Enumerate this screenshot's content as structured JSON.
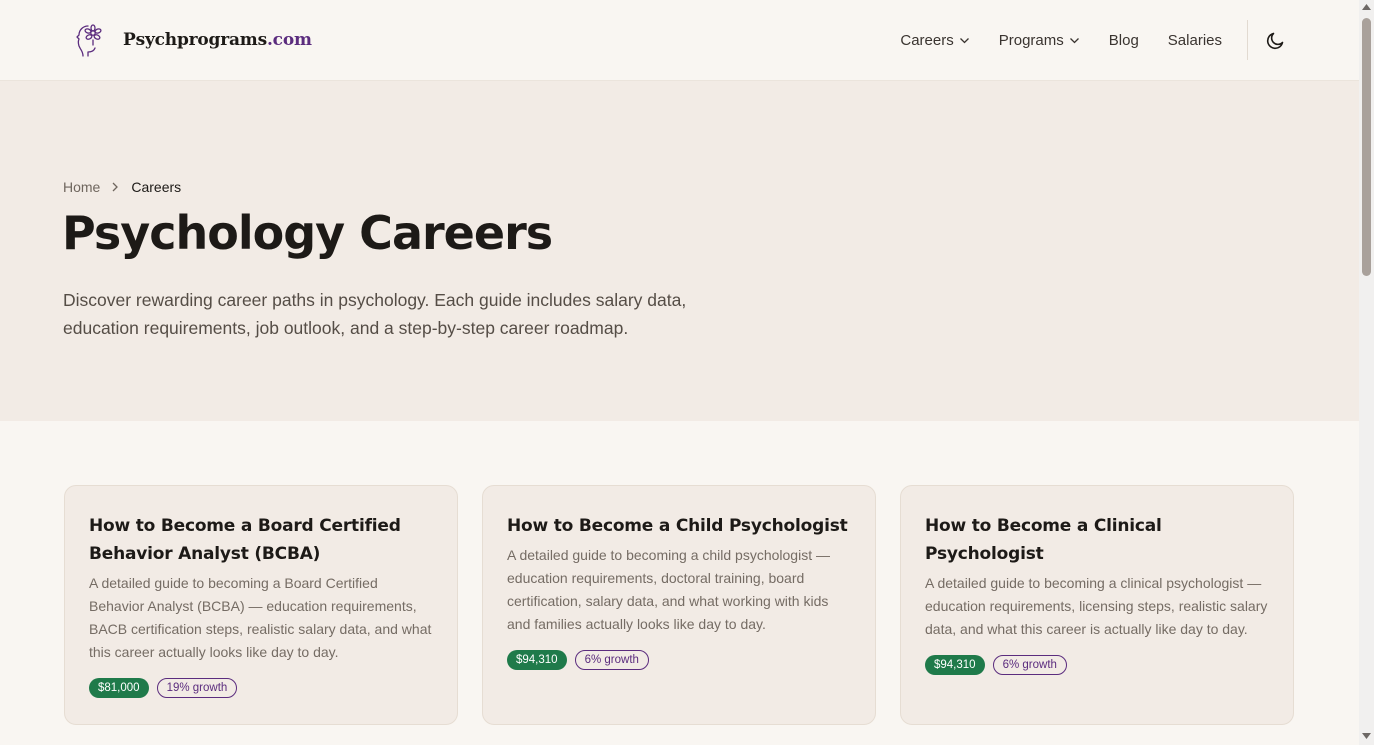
{
  "header": {
    "logo_name": "Psychprograms",
    "logo_tld": ".com",
    "nav": [
      {
        "label": "Careers",
        "has_dropdown": true
      },
      {
        "label": "Programs",
        "has_dropdown": true
      },
      {
        "label": "Blog",
        "has_dropdown": false
      },
      {
        "label": "Salaries",
        "has_dropdown": false
      }
    ],
    "theme_icon": "moon-icon"
  },
  "breadcrumb": {
    "home": "Home",
    "current": "Careers"
  },
  "hero": {
    "title": "Psychology Careers",
    "description": "Discover rewarding career paths in psychology. Each guide includes salary data, education requirements, job outlook, and a step-by-step career roadmap."
  },
  "cards": [
    {
      "title": "How to Become a Board Certified Behavior Analyst (BCBA)",
      "description": "A detailed guide to becoming a Board Certified Behavior Analyst (BCBA) — education requirements, BACB certification steps, realistic salary data, and what this career actually looks like day to day.",
      "salary": "$81,000",
      "growth": "19% growth"
    },
    {
      "title": "How to Become a Child Psychologist",
      "description": "A detailed guide to becoming a child psychologist — education requirements, doctoral training, board certification, salary data, and what working with kids and families actually looks like day to day.",
      "salary": "$94,310",
      "growth": "6% growth"
    },
    {
      "title": "How to Become a Clinical Psychologist",
      "description": "A detailed guide to becoming a clinical psychologist — education requirements, licensing steps, realistic salary data, and what this career is actually like day to day.",
      "salary": "$94,310",
      "growth": "6% growth"
    }
  ],
  "colors": {
    "brand_purple": "#5b2c7e",
    "salary_green": "#1f7a4a",
    "hero_bg": "#f2ebe5",
    "page_bg": "#f9f6f2"
  }
}
